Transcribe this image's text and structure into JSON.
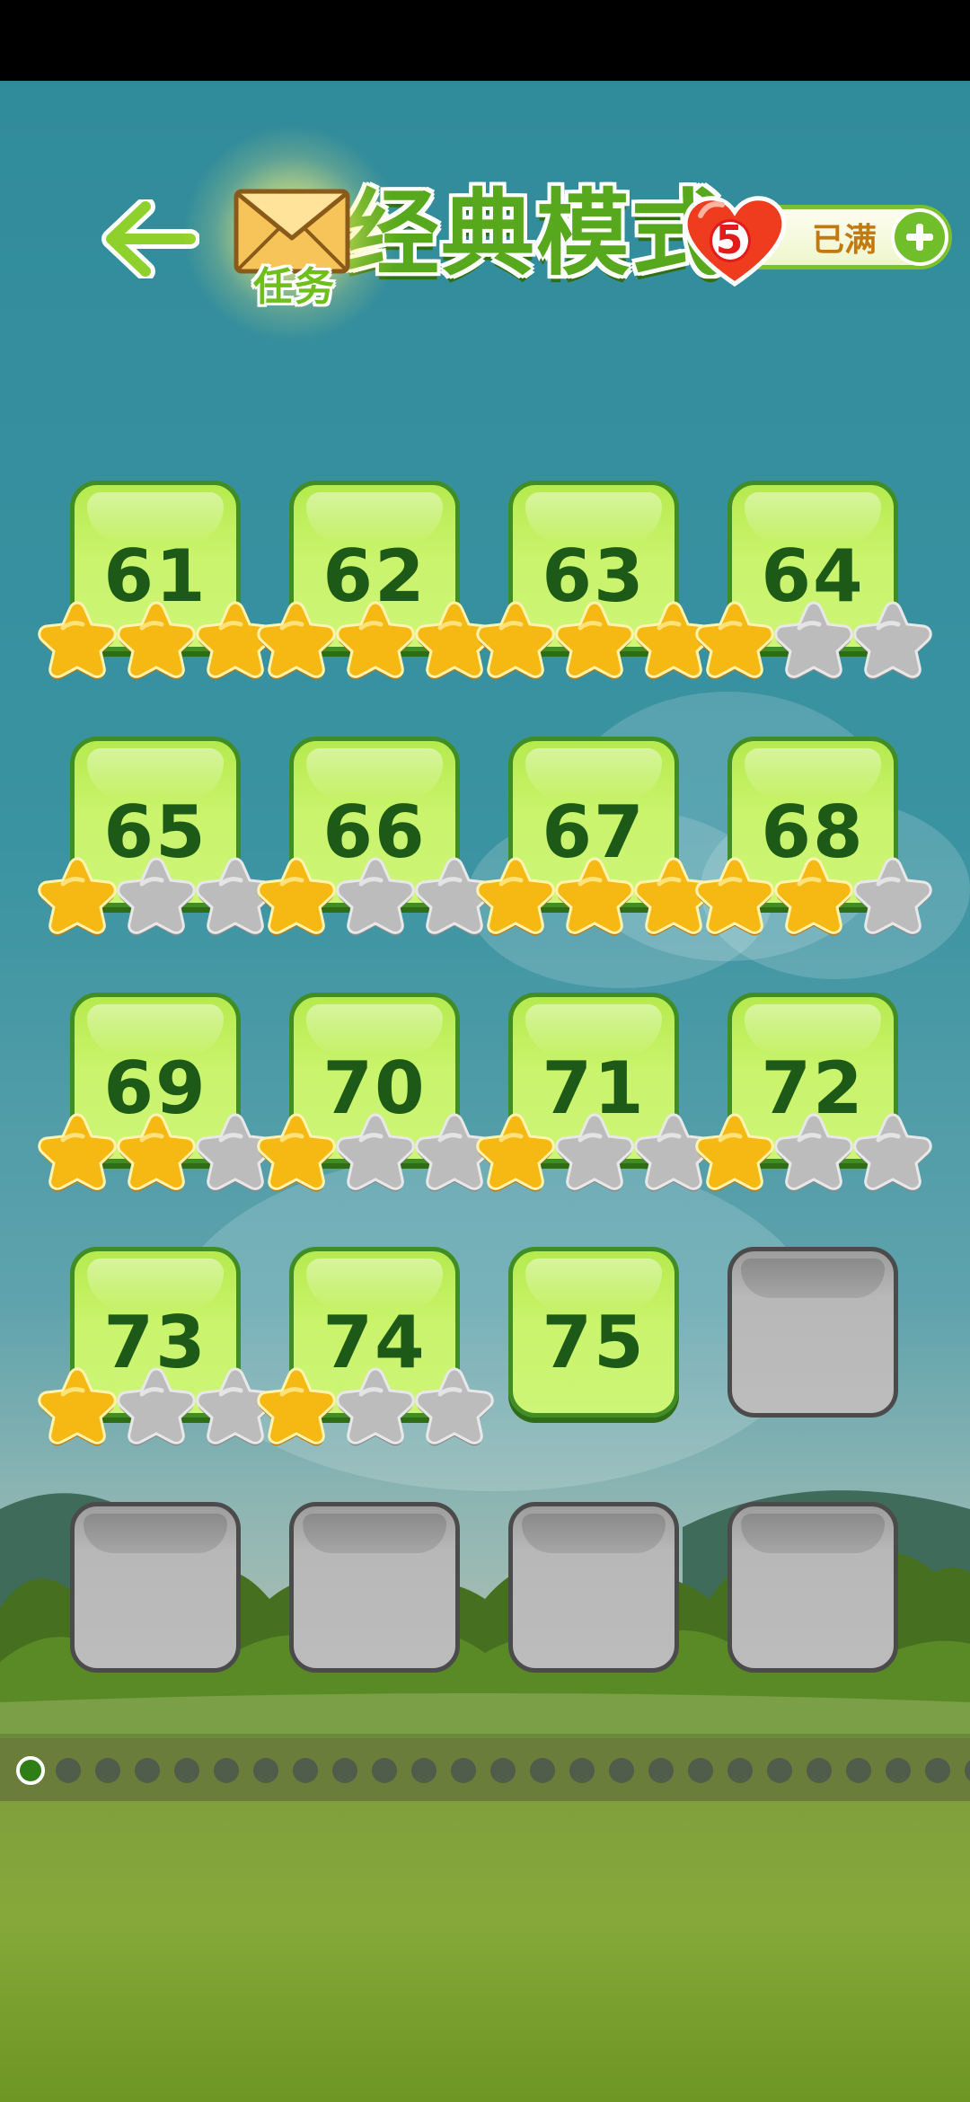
{
  "header": {
    "title": "经典模式",
    "task_label": "任务",
    "lives": {
      "count": "5",
      "status": "已满"
    }
  },
  "levels": [
    {
      "number": "61",
      "stars": 3,
      "locked": false
    },
    {
      "number": "62",
      "stars": 3,
      "locked": false
    },
    {
      "number": "63",
      "stars": 3,
      "locked": false
    },
    {
      "number": "64",
      "stars": 1,
      "locked": false
    },
    {
      "number": "65",
      "stars": 1,
      "locked": false
    },
    {
      "number": "66",
      "stars": 1,
      "locked": false
    },
    {
      "number": "67",
      "stars": 3,
      "locked": false
    },
    {
      "number": "68",
      "stars": 2,
      "locked": false
    },
    {
      "number": "69",
      "stars": 2,
      "locked": false
    },
    {
      "number": "70",
      "stars": 1,
      "locked": false
    },
    {
      "number": "71",
      "stars": 1,
      "locked": false
    },
    {
      "number": "72",
      "stars": 1,
      "locked": false
    },
    {
      "number": "73",
      "stars": 1,
      "locked": false
    },
    {
      "number": "74",
      "stars": 1,
      "locked": false
    },
    {
      "number": "75",
      "stars": null,
      "locked": false
    },
    {
      "number": "",
      "stars": null,
      "locked": true
    },
    {
      "number": "",
      "stars": null,
      "locked": true
    },
    {
      "number": "",
      "stars": null,
      "locked": true
    },
    {
      "number": "",
      "stars": null,
      "locked": true
    },
    {
      "number": "",
      "stars": null,
      "locked": true
    }
  ],
  "pagination": {
    "total_pages": 25,
    "current_page": 1
  },
  "colors": {
    "star_gold": "#f6b812",
    "star_gray": "#bcbcbc",
    "tile_border": "#3f8d24",
    "number": "#1d5a17"
  },
  "icons": {
    "back": "back-arrow-icon",
    "task": "envelope-icon",
    "heart": "heart-icon",
    "add": "plus-icon",
    "star": "star-icon"
  }
}
